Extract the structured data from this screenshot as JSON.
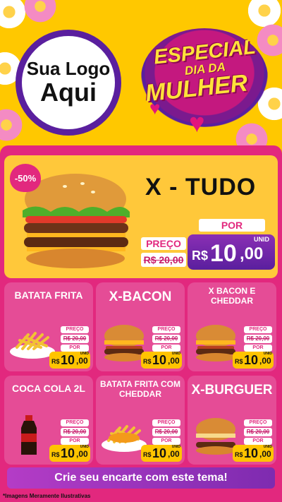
{
  "logo": {
    "line1": "Sua Logo",
    "line2": "Aqui"
  },
  "badge": {
    "line1": "ESPECIAL",
    "line2": "DIA DA",
    "line3": "MULHER"
  },
  "hero": {
    "title": "X - TUDO",
    "discount": "-50%",
    "preco_label": "PREÇO",
    "old_price": "R$ 20,00",
    "por_label": "POR",
    "unid_label": "UNID",
    "currency": "R$",
    "price_int": "10",
    "price_dec": ",00"
  },
  "products": [
    {
      "title": "BATATA FRITA",
      "preco_label": "PREÇO",
      "old_price": "R$ 20,00",
      "por_label": "POR",
      "unid_label": "UNID",
      "currency": "R$",
      "price_int": "10",
      "price_dec": ",00"
    },
    {
      "title": "X-BACON",
      "preco_label": "PREÇO",
      "old_price": "R$ 20,00",
      "por_label": "POR",
      "unid_label": "UNID",
      "currency": "R$",
      "price_int": "10",
      "price_dec": ",00"
    },
    {
      "title": "X BACON E CHEDDAR",
      "preco_label": "PREÇO",
      "old_price": "R$ 20,00",
      "por_label": "POR",
      "unid_label": "UNID",
      "currency": "R$",
      "price_int": "10",
      "price_dec": ",00"
    },
    {
      "title": "COCA COLA 2L",
      "preco_label": "PREÇO",
      "old_price": "R$ 20,00",
      "por_label": "POR",
      "unid_label": "UNID",
      "currency": "R$",
      "price_int": "10",
      "price_dec": ",00"
    },
    {
      "title": "BATATA FRITA COM CHEDDAR",
      "preco_label": "PREÇO",
      "old_price": "R$ 20,00",
      "por_label": "POR",
      "unid_label": "UNID",
      "currency": "R$",
      "price_int": "10",
      "price_dec": ",00"
    },
    {
      "title": "X-BURGUER",
      "preco_label": "PREÇO",
      "old_price": "R$ 20,00",
      "por_label": "POR",
      "unid_label": "UNID",
      "currency": "R$",
      "price_int": "10",
      "price_dec": ",00"
    }
  ],
  "banner": "Crie seu encarte com este tema!",
  "footer": "*Imagens Meramente Ilustrativas",
  "colors": {
    "background_top": "#ffc800",
    "menu_pink": "#e2287e",
    "purple": "#5a1f9e",
    "yellow": "#ffc400"
  }
}
